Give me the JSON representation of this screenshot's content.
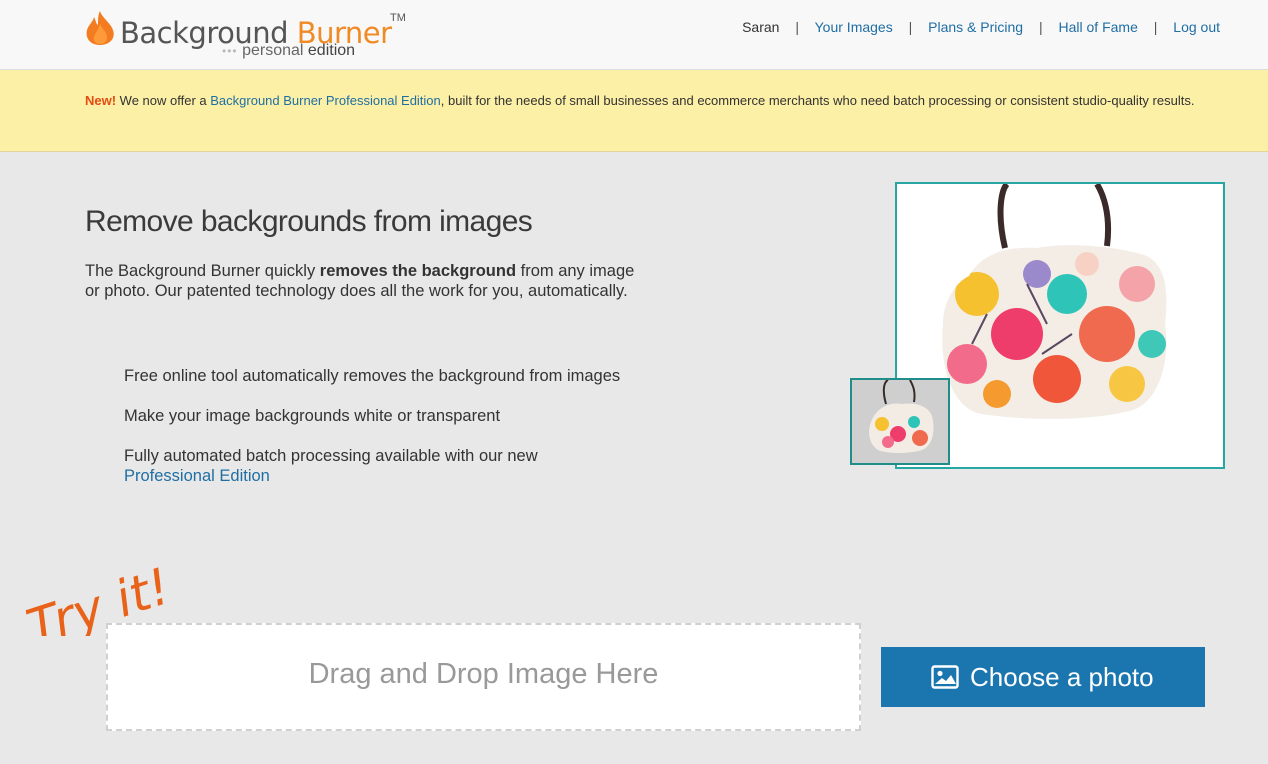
{
  "header": {
    "logo": {
      "title_part1": "Background",
      "title_part2": "Burner",
      "trademark": "TM",
      "subtitle_dots": "•••",
      "subtitle_personal": "personal",
      "subtitle_edition": "edition"
    },
    "nav": {
      "user": "Saran",
      "separator": "|",
      "your_images": "Your Images",
      "plans_pricing": "Plans & Pricing",
      "hall_of_fame": "Hall of Fame",
      "log_out": "Log out"
    }
  },
  "notice": {
    "badge": "New!",
    "text_before": " We now offer a ",
    "link": "Background Burner Professional Edition",
    "text_after": ", built for the needs of small businesses and ecommerce merchants who need batch processing or consistent studio-quality results."
  },
  "main": {
    "headline": "Remove backgrounds from images",
    "intro_before": "The Background Burner quickly ",
    "intro_bold": "removes the background",
    "intro_after": " from any image or photo. Our patented technology does all the work for you, automatically.",
    "features": [
      "Free online tool automatically removes the background from images",
      "Make your image backgrounds white or transparent",
      "Fully automated batch processing available with our new"
    ],
    "feature_link": "Professional Edition",
    "try_it": "Try it!"
  },
  "upload": {
    "drop_text": "Drag and Drop Image Here",
    "choose_button": "Choose a photo"
  },
  "colors": {
    "brand_orange": "#f08a24",
    "link_blue": "#1f6ea4",
    "button_blue": "#1b76b0",
    "notice_yellow": "#fcefa6",
    "preview_border": "#27a7a4",
    "try_it_orange": "#e8621a"
  },
  "icons": {
    "logo": "flame-icon",
    "button": "image-icon"
  }
}
